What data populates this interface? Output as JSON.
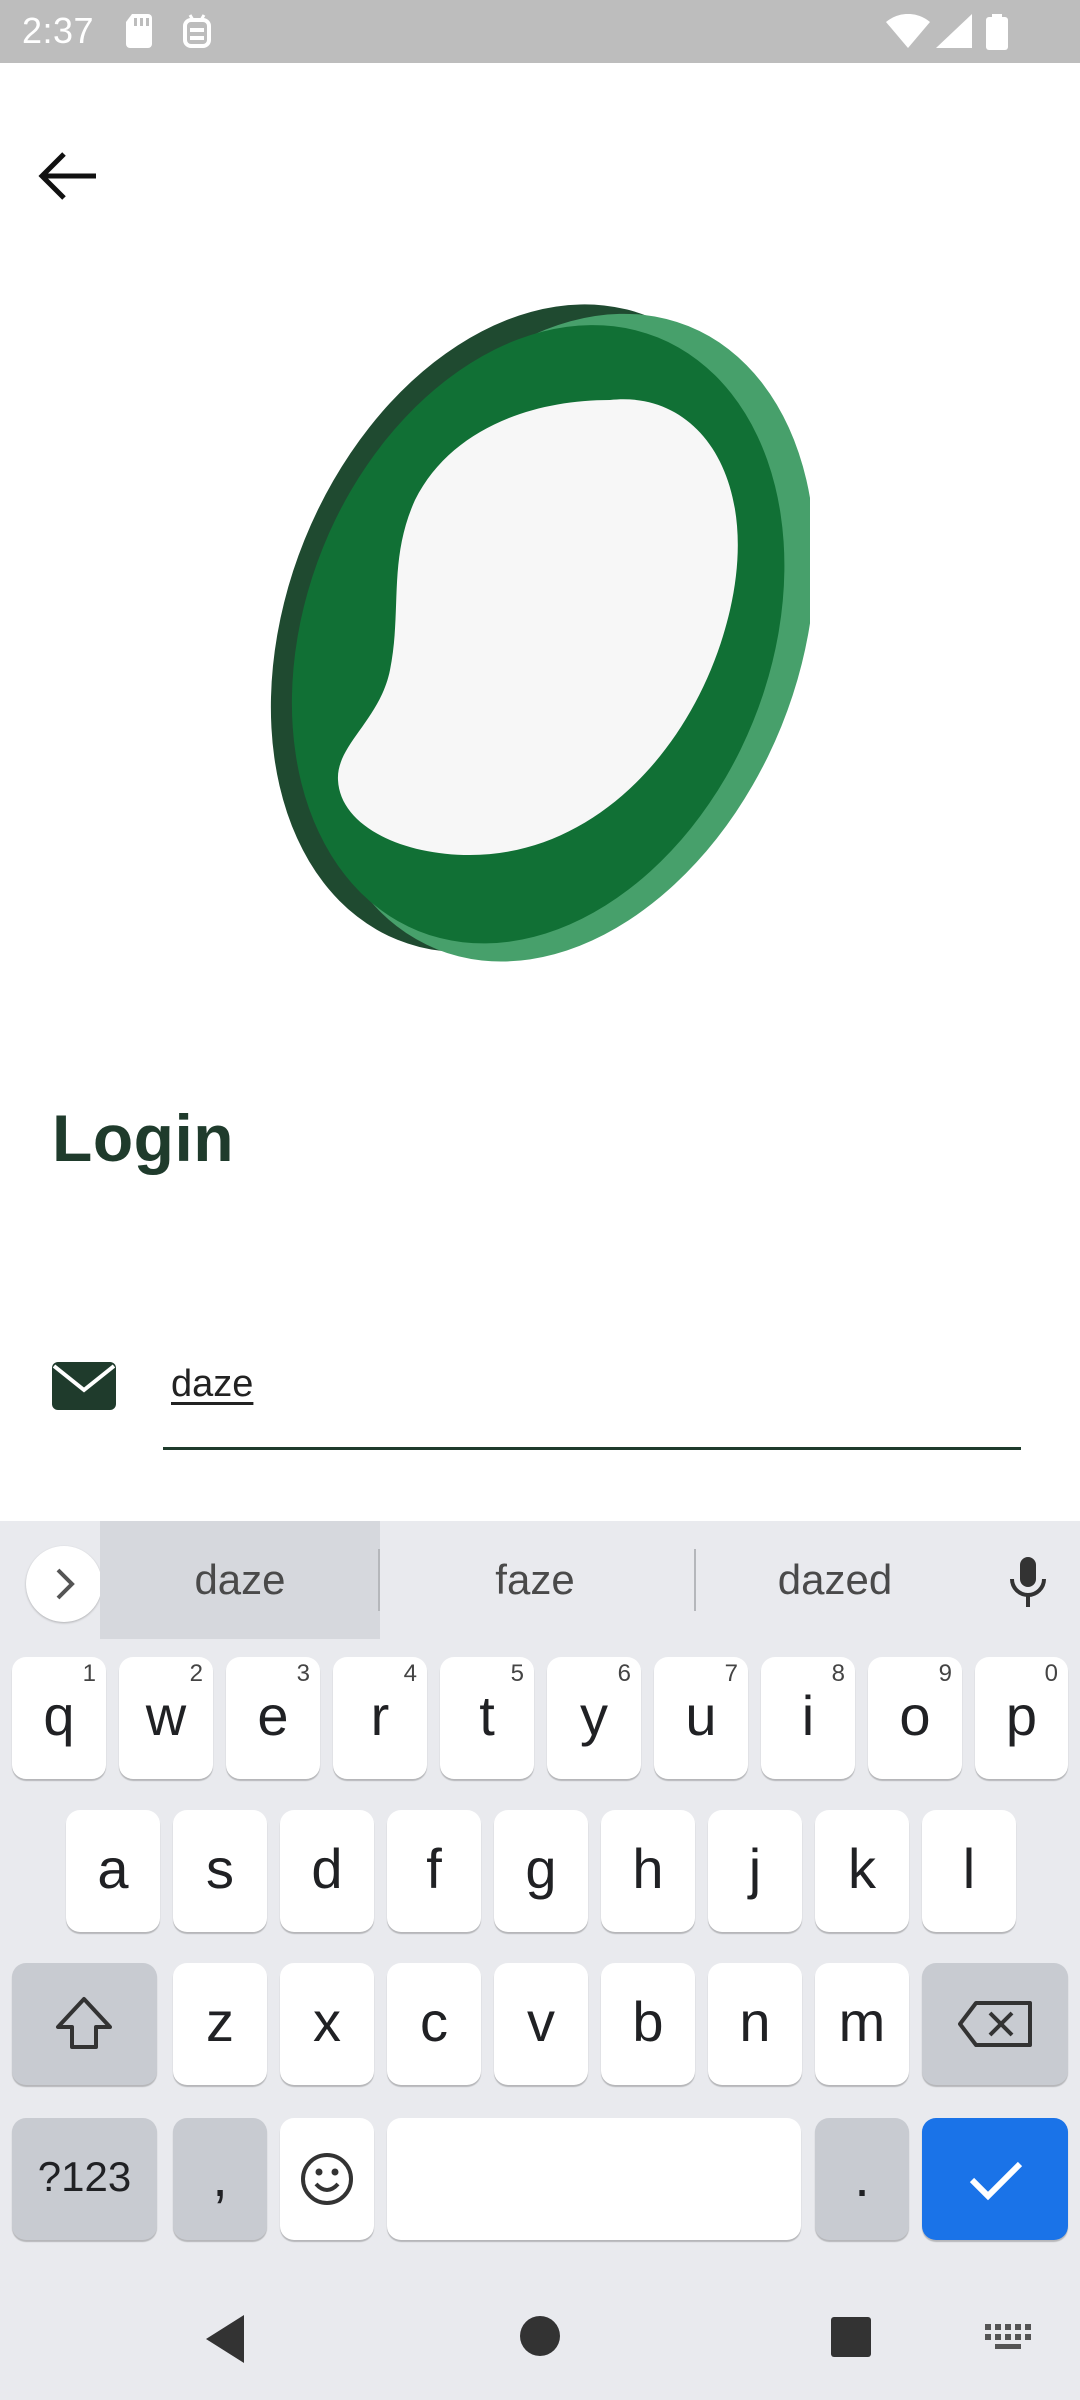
{
  "status_bar": {
    "time": "2:37"
  },
  "page": {
    "title": "Login"
  },
  "email_field": {
    "value": "daze"
  },
  "icons": {
    "back": "arrow-left-icon",
    "email": "envelope-icon",
    "logo": "green-ring-logo"
  },
  "colors": {
    "primary_dark": "#1f3b2c",
    "logo_green": "#117035",
    "logo_light_green": "#47a06b",
    "keyboard_accent": "#1a73e8"
  },
  "keyboard": {
    "suggestions": [
      "daze",
      "faze",
      "dazed"
    ],
    "row1": [
      {
        "k": "q",
        "h": "1"
      },
      {
        "k": "w",
        "h": "2"
      },
      {
        "k": "e",
        "h": "3"
      },
      {
        "k": "r",
        "h": "4"
      },
      {
        "k": "t",
        "h": "5"
      },
      {
        "k": "y",
        "h": "6"
      },
      {
        "k": "u",
        "h": "7"
      },
      {
        "k": "i",
        "h": "8"
      },
      {
        "k": "o",
        "h": "9"
      },
      {
        "k": "p",
        "h": "0"
      }
    ],
    "row2": [
      "a",
      "s",
      "d",
      "f",
      "g",
      "h",
      "j",
      "k",
      "l"
    ],
    "row3": [
      "z",
      "x",
      "c",
      "v",
      "b",
      "n",
      "m"
    ],
    "symbols_label": "?123",
    "comma_label": ",",
    "period_label": "."
  }
}
